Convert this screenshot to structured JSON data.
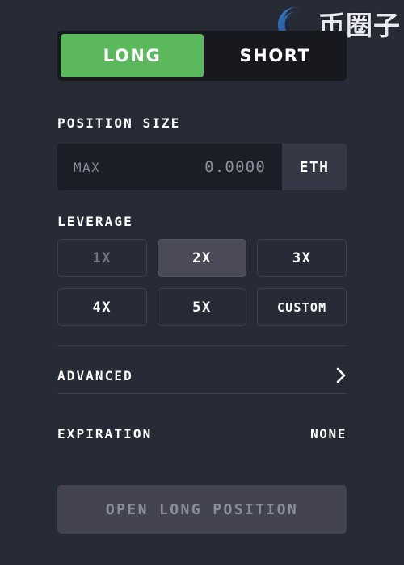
{
  "watermark": {
    "logo_icon": "swirl-logo-icon",
    "text": "币圈子",
    "colors": {
      "logo_outer": "#2f6fb5",
      "logo_inner": "#1b2a5c"
    }
  },
  "side_toggle": {
    "name": "position-side-toggle",
    "options": [
      {
        "label": "LONG",
        "active": true
      },
      {
        "label": "SHORT",
        "active": false
      }
    ],
    "active_color": "#5cb85c",
    "track_color": "#17191f"
  },
  "position_size": {
    "heading": "POSITION SIZE",
    "max_label": "MAX",
    "value": "0.0000",
    "placeholder": "0.0000",
    "unit": "ETH"
  },
  "leverage": {
    "heading": "LEVERAGE",
    "options": [
      {
        "label": "1X",
        "state": "disabled"
      },
      {
        "label": "2X",
        "state": "selected"
      },
      {
        "label": "3X",
        "state": "normal"
      },
      {
        "label": "4X",
        "state": "normal"
      },
      {
        "label": "5X",
        "state": "normal"
      },
      {
        "label": "CUSTOM",
        "state": "normal"
      }
    ],
    "selected_bg": "#4a4b56"
  },
  "advanced": {
    "label": "ADVANCED",
    "chevron_icon": "chevron-right-icon"
  },
  "expiration": {
    "label": "EXPIRATION",
    "value": "NONE"
  },
  "submit": {
    "label": "OPEN LONG POSITION",
    "disabled": true,
    "bg": "#434450",
    "text_color": "#8b8f9c"
  },
  "theme": {
    "background": "#262b36",
    "divider": "#3b414e",
    "input_bg": "#1b1e26",
    "unit_bg": "#343945"
  }
}
